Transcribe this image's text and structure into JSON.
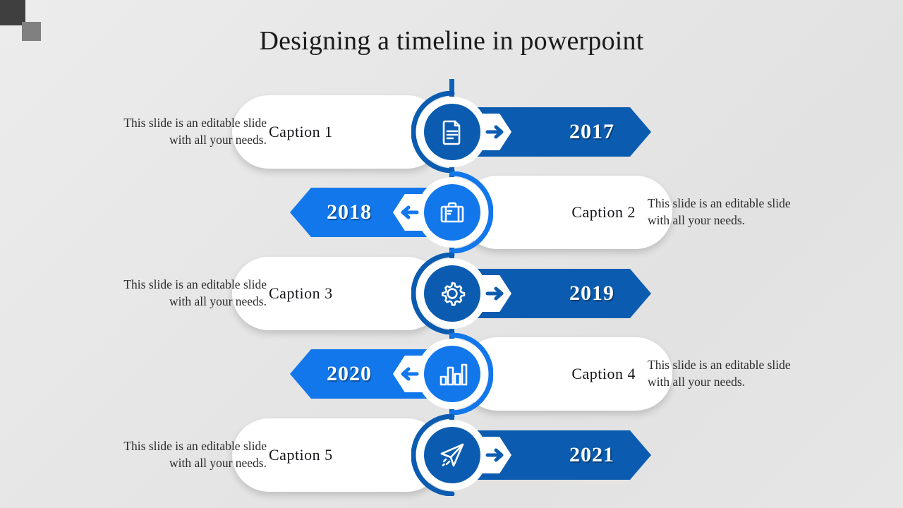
{
  "slide": {
    "title": "Designing a timeline in powerpoint",
    "background_color": "#e6e6e6",
    "decor": {
      "dark_square_color": "#3f3f3f",
      "gray_square_color": "#808080"
    }
  },
  "theme": {
    "dark_blue": "#0b5cb0",
    "bright_blue": "#1277eb",
    "spine_color": "#0e63b4",
    "pill_color": "#ffffff",
    "year_text_color": "#ffffff"
  },
  "timeline": {
    "rows": [
      {
        "year": "2017",
        "caption": "Caption  1",
        "description": "This slide is an editable slide with all your needs.",
        "icon": "document-icon",
        "direction": "right",
        "accent": "#0b5cb0"
      },
      {
        "year": "2018",
        "caption": "Caption  2",
        "description": "This slide is an editable slide with all your needs.",
        "icon": "briefcase-icon",
        "direction": "left",
        "accent": "#1277eb"
      },
      {
        "year": "2019",
        "caption": "Caption  3",
        "description": "This slide is an editable slide with all your needs.",
        "icon": "gear-icon",
        "direction": "right",
        "accent": "#0b5cb0"
      },
      {
        "year": "2020",
        "caption": "Caption  4",
        "description": "This slide is an editable slide with all your needs.",
        "icon": "bar-chart-icon",
        "direction": "left",
        "accent": "#1277eb"
      },
      {
        "year": "2021",
        "caption": "Caption  5",
        "description": "This slide is an editable slide with all your needs.",
        "icon": "paper-plane-icon",
        "direction": "right",
        "accent": "#0b5cb0"
      }
    ]
  }
}
